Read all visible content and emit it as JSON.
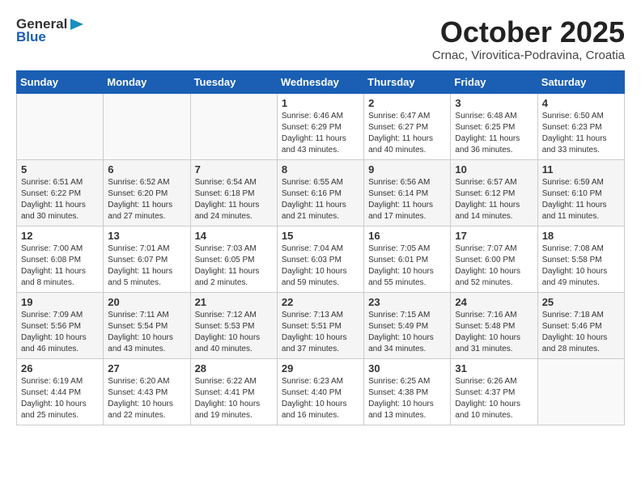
{
  "header": {
    "logo_general": "General",
    "logo_blue": "Blue",
    "month_title": "October 2025",
    "location": "Crnac, Virovitica-Podravina, Croatia"
  },
  "weekdays": [
    "Sunday",
    "Monday",
    "Tuesday",
    "Wednesday",
    "Thursday",
    "Friday",
    "Saturday"
  ],
  "weeks": [
    [
      {
        "day": "",
        "info": ""
      },
      {
        "day": "",
        "info": ""
      },
      {
        "day": "",
        "info": ""
      },
      {
        "day": "1",
        "info": "Sunrise: 6:46 AM\nSunset: 6:29 PM\nDaylight: 11 hours\nand 43 minutes."
      },
      {
        "day": "2",
        "info": "Sunrise: 6:47 AM\nSunset: 6:27 PM\nDaylight: 11 hours\nand 40 minutes."
      },
      {
        "day": "3",
        "info": "Sunrise: 6:48 AM\nSunset: 6:25 PM\nDaylight: 11 hours\nand 36 minutes."
      },
      {
        "day": "4",
        "info": "Sunrise: 6:50 AM\nSunset: 6:23 PM\nDaylight: 11 hours\nand 33 minutes."
      }
    ],
    [
      {
        "day": "5",
        "info": "Sunrise: 6:51 AM\nSunset: 6:22 PM\nDaylight: 11 hours\nand 30 minutes."
      },
      {
        "day": "6",
        "info": "Sunrise: 6:52 AM\nSunset: 6:20 PM\nDaylight: 11 hours\nand 27 minutes."
      },
      {
        "day": "7",
        "info": "Sunrise: 6:54 AM\nSunset: 6:18 PM\nDaylight: 11 hours\nand 24 minutes."
      },
      {
        "day": "8",
        "info": "Sunrise: 6:55 AM\nSunset: 6:16 PM\nDaylight: 11 hours\nand 21 minutes."
      },
      {
        "day": "9",
        "info": "Sunrise: 6:56 AM\nSunset: 6:14 PM\nDaylight: 11 hours\nand 17 minutes."
      },
      {
        "day": "10",
        "info": "Sunrise: 6:57 AM\nSunset: 6:12 PM\nDaylight: 11 hours\nand 14 minutes."
      },
      {
        "day": "11",
        "info": "Sunrise: 6:59 AM\nSunset: 6:10 PM\nDaylight: 11 hours\nand 11 minutes."
      }
    ],
    [
      {
        "day": "12",
        "info": "Sunrise: 7:00 AM\nSunset: 6:08 PM\nDaylight: 11 hours\nand 8 minutes."
      },
      {
        "day": "13",
        "info": "Sunrise: 7:01 AM\nSunset: 6:07 PM\nDaylight: 11 hours\nand 5 minutes."
      },
      {
        "day": "14",
        "info": "Sunrise: 7:03 AM\nSunset: 6:05 PM\nDaylight: 11 hours\nand 2 minutes."
      },
      {
        "day": "15",
        "info": "Sunrise: 7:04 AM\nSunset: 6:03 PM\nDaylight: 10 hours\nand 59 minutes."
      },
      {
        "day": "16",
        "info": "Sunrise: 7:05 AM\nSunset: 6:01 PM\nDaylight: 10 hours\nand 55 minutes."
      },
      {
        "day": "17",
        "info": "Sunrise: 7:07 AM\nSunset: 6:00 PM\nDaylight: 10 hours\nand 52 minutes."
      },
      {
        "day": "18",
        "info": "Sunrise: 7:08 AM\nSunset: 5:58 PM\nDaylight: 10 hours\nand 49 minutes."
      }
    ],
    [
      {
        "day": "19",
        "info": "Sunrise: 7:09 AM\nSunset: 5:56 PM\nDaylight: 10 hours\nand 46 minutes."
      },
      {
        "day": "20",
        "info": "Sunrise: 7:11 AM\nSunset: 5:54 PM\nDaylight: 10 hours\nand 43 minutes."
      },
      {
        "day": "21",
        "info": "Sunrise: 7:12 AM\nSunset: 5:53 PM\nDaylight: 10 hours\nand 40 minutes."
      },
      {
        "day": "22",
        "info": "Sunrise: 7:13 AM\nSunset: 5:51 PM\nDaylight: 10 hours\nand 37 minutes."
      },
      {
        "day": "23",
        "info": "Sunrise: 7:15 AM\nSunset: 5:49 PM\nDaylight: 10 hours\nand 34 minutes."
      },
      {
        "day": "24",
        "info": "Sunrise: 7:16 AM\nSunset: 5:48 PM\nDaylight: 10 hours\nand 31 minutes."
      },
      {
        "day": "25",
        "info": "Sunrise: 7:18 AM\nSunset: 5:46 PM\nDaylight: 10 hours\nand 28 minutes."
      }
    ],
    [
      {
        "day": "26",
        "info": "Sunrise: 6:19 AM\nSunset: 4:44 PM\nDaylight: 10 hours\nand 25 minutes."
      },
      {
        "day": "27",
        "info": "Sunrise: 6:20 AM\nSunset: 4:43 PM\nDaylight: 10 hours\nand 22 minutes."
      },
      {
        "day": "28",
        "info": "Sunrise: 6:22 AM\nSunset: 4:41 PM\nDaylight: 10 hours\nand 19 minutes."
      },
      {
        "day": "29",
        "info": "Sunrise: 6:23 AM\nSunset: 4:40 PM\nDaylight: 10 hours\nand 16 minutes."
      },
      {
        "day": "30",
        "info": "Sunrise: 6:25 AM\nSunset: 4:38 PM\nDaylight: 10 hours\nand 13 minutes."
      },
      {
        "day": "31",
        "info": "Sunrise: 6:26 AM\nSunset: 4:37 PM\nDaylight: 10 hours\nand 10 minutes."
      },
      {
        "day": "",
        "info": ""
      }
    ]
  ]
}
